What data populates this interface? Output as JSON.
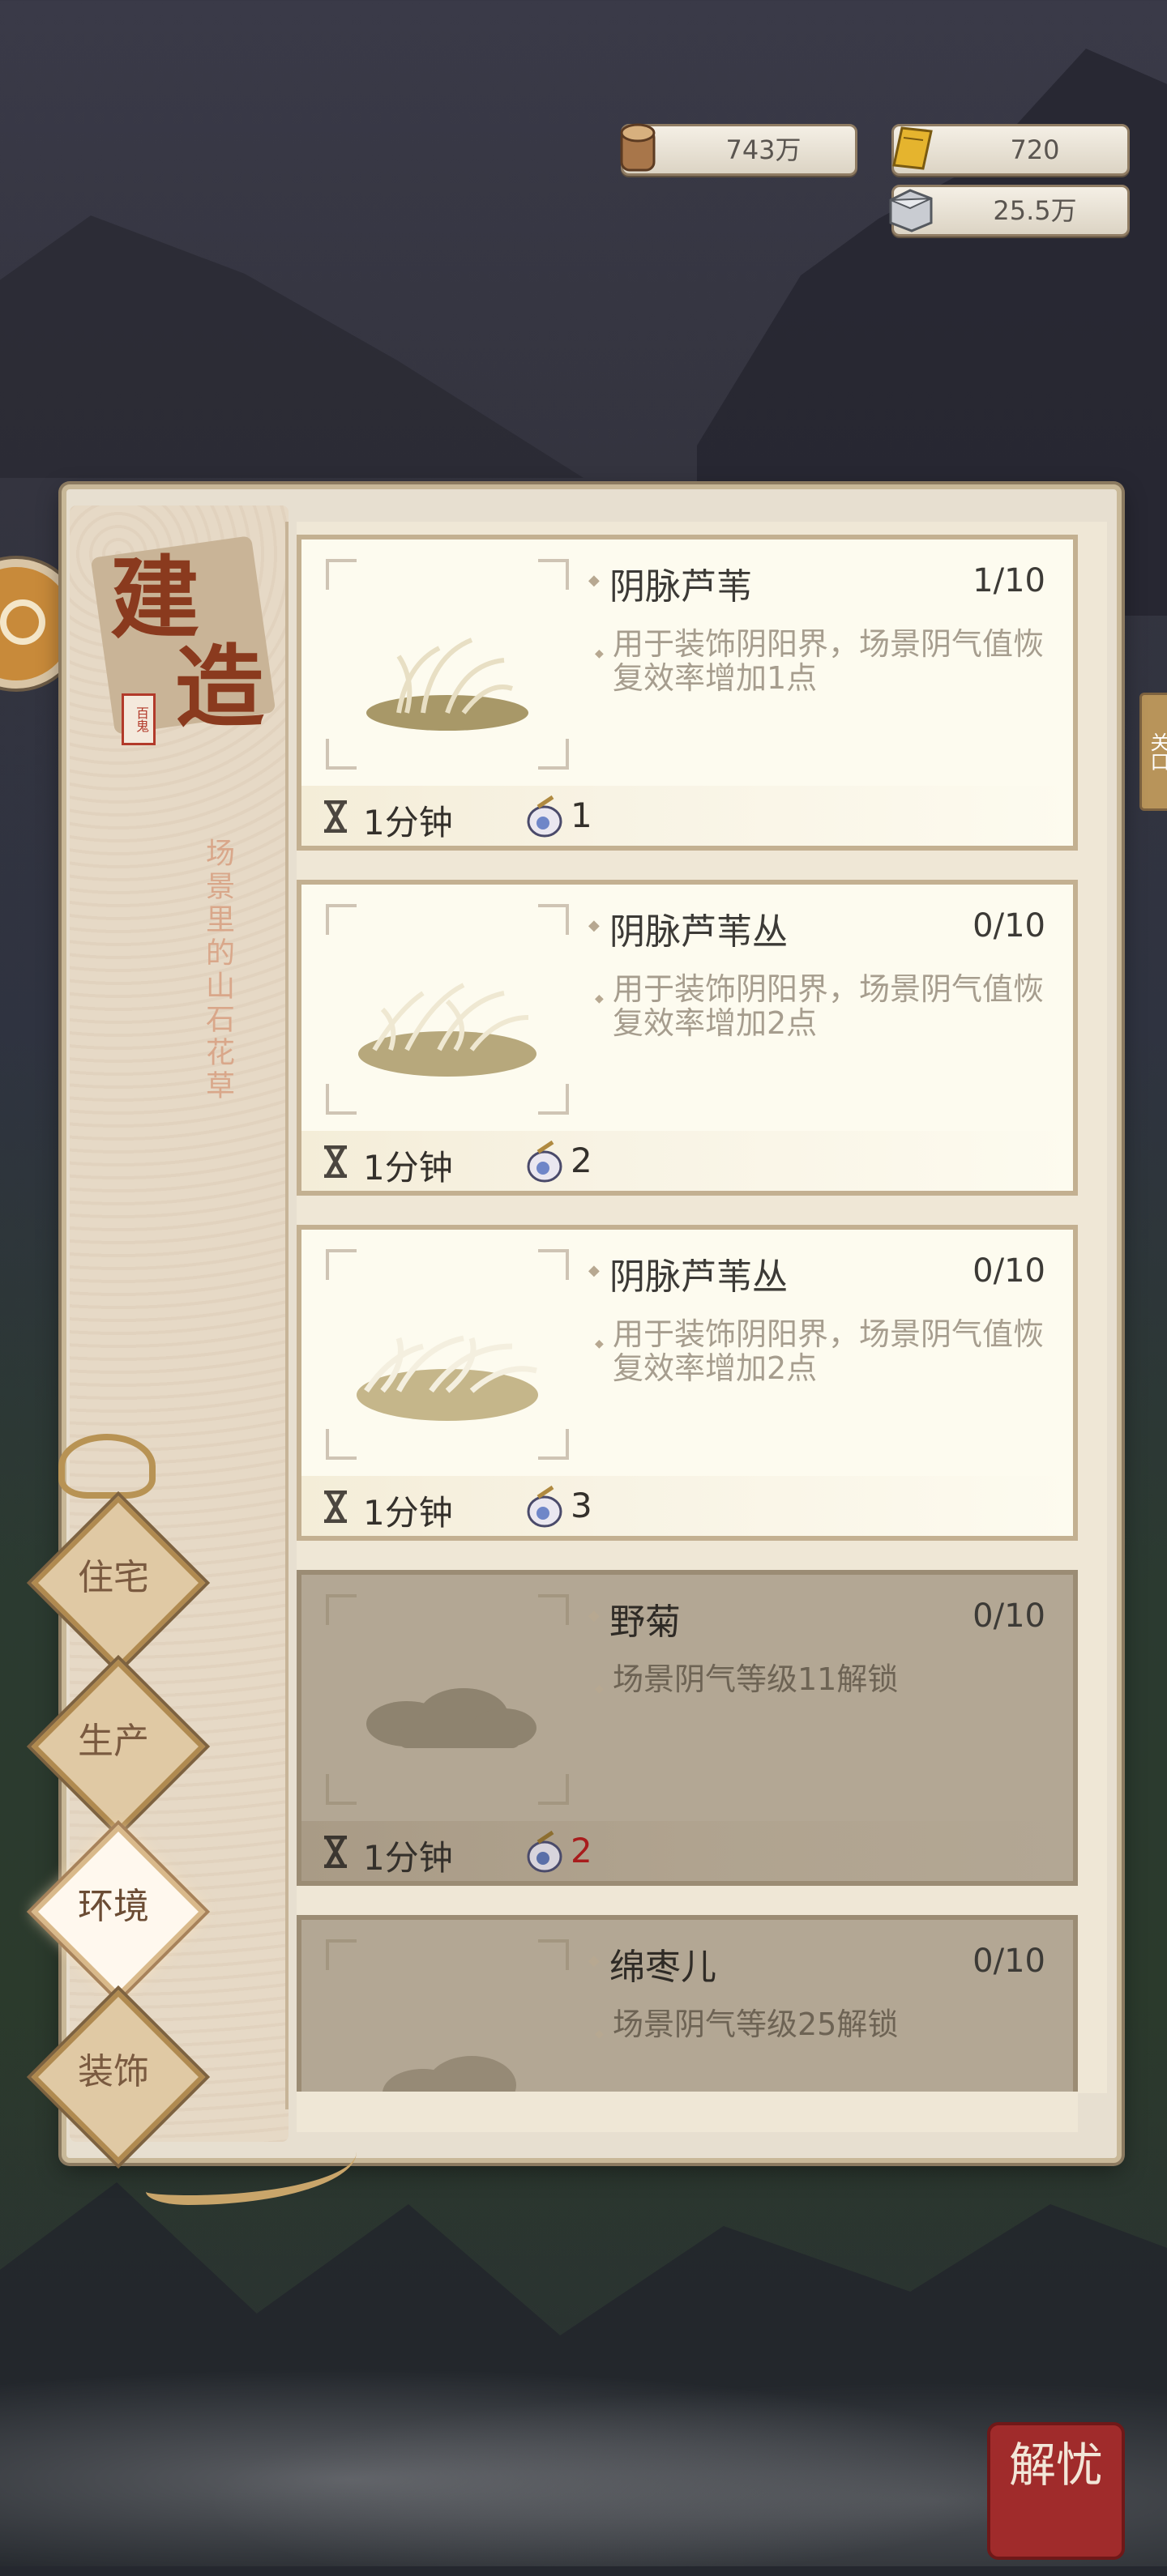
{
  "resources": {
    "wood": {
      "value": "743万",
      "icon": "wood-log-icon"
    },
    "gold": {
      "value": "720",
      "icon": "gold-scroll-icon"
    },
    "stone": {
      "value": "25.5万",
      "icon": "stone-block-icon"
    }
  },
  "panel": {
    "title_chars": [
      "建",
      "造"
    ],
    "seal": "百鬼",
    "subtitle": "场景里的山石花草"
  },
  "tabs": [
    {
      "label": "住宅",
      "active": false
    },
    {
      "label": "生产",
      "active": false
    },
    {
      "label": "环境",
      "active": true
    },
    {
      "label": "装饰",
      "active": false
    }
  ],
  "items": [
    {
      "name": "阴脉芦苇",
      "count": "1/10",
      "desc": "用于装饰阴阳界，场景阴气值恢复效率增加1点",
      "time": "1分钟",
      "cost": "1",
      "locked": false
    },
    {
      "name": "阴脉芦苇丛",
      "count": "0/10",
      "desc": "用于装饰阴阳界，场景阴气值恢复效率增加2点",
      "time": "1分钟",
      "cost": "2",
      "locked": false
    },
    {
      "name": "阴脉芦苇丛",
      "count": "0/10",
      "desc": "用于装饰阴阳界，场景阴气值恢复效率增加2点",
      "time": "1分钟",
      "cost": "3",
      "locked": false
    },
    {
      "name": "野菊",
      "count": "0/10",
      "desc": "场景阴气等级11解锁",
      "time": "1分钟",
      "cost": "2",
      "locked": true
    },
    {
      "name": "绵枣儿",
      "count": "0/10",
      "desc": "场景阴气等级25解锁",
      "time": "",
      "cost": "",
      "locked": true
    }
  ],
  "side": {
    "right_tag": "关口",
    "corner_button": "解忧"
  }
}
